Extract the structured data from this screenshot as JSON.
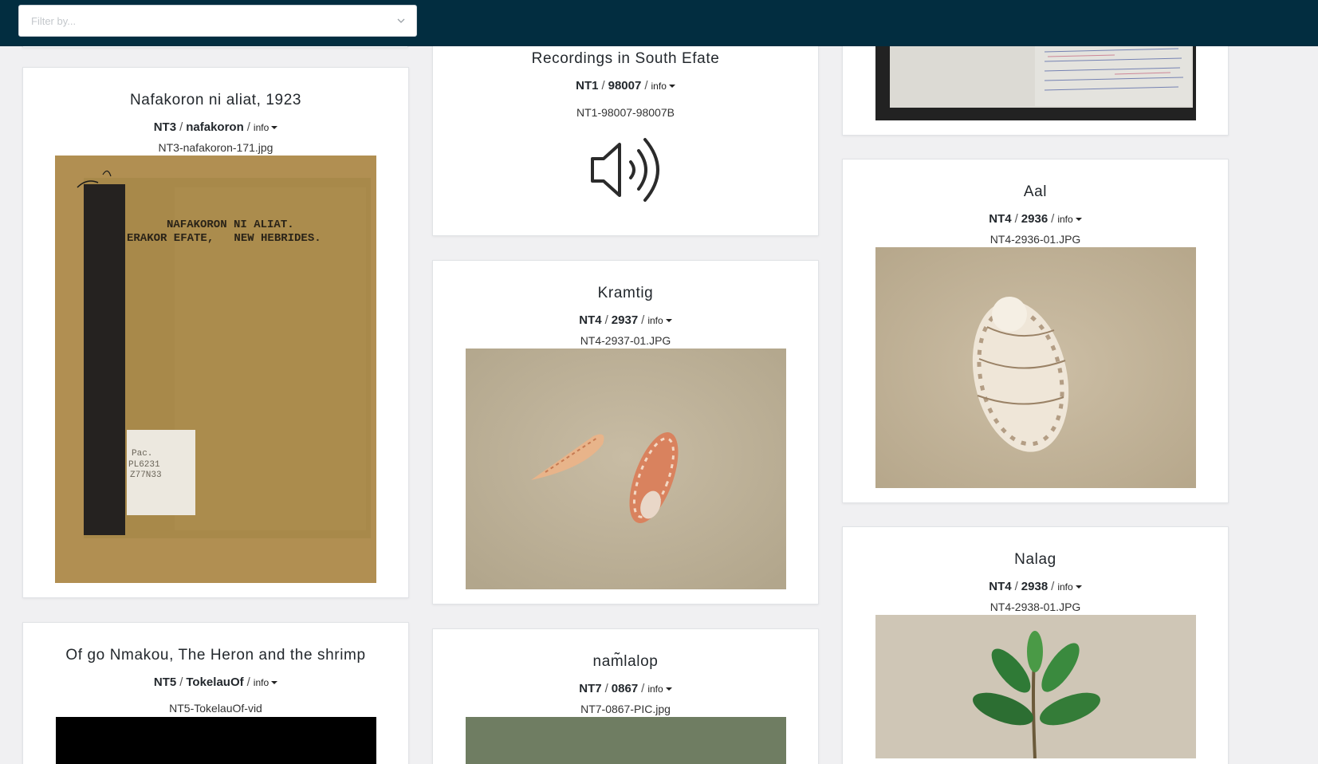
{
  "filter": {
    "placeholder": "Filter by..."
  },
  "cards": {
    "nafakoron": {
      "title": "Nafakoron ni aliat, 1923",
      "collection": "NT3",
      "item": "nafakoron",
      "info": "info",
      "filename": "NT3-nafakoron-171.jpg",
      "cover_line1": "NAFAKORON NI ALIAT.",
      "cover_line2": "ERAKOR EFATE,   NEW HEBRIDES.",
      "label_line1": "Pac.",
      "label_line2": "PL6231",
      "label_line3": "Z77N33"
    },
    "heron": {
      "title": "Of go Nmakou, The Heron and the shrimp",
      "collection": "NT5",
      "item": "TokelauOf",
      "info": "info",
      "filename": "NT5-TokelauOf-vid"
    },
    "recordings": {
      "title": "Recordings in South Efate",
      "collection": "NT1",
      "item": "98007",
      "info": "info",
      "filename": "NT1-98007-98007B"
    },
    "kramtig": {
      "title": "Kramtig",
      "collection": "NT4",
      "item": "2937",
      "info": "info",
      "filename": "NT4-2937-01.JPG"
    },
    "namlalop": {
      "title": "nam̃lalop",
      "collection": "NT7",
      "item": "0867",
      "info": "info",
      "filename": "NT7-0867-PIC.jpg"
    },
    "aal": {
      "title": "Aal",
      "collection": "NT4",
      "item": "2936",
      "info": "info",
      "filename": "NT4-2936-01.JPG"
    },
    "nalag": {
      "title": "Nalag",
      "collection": "NT4",
      "item": "2938",
      "info": "info",
      "filename": "NT4-2938-01.JPG"
    }
  },
  "icons": {
    "audio": "speaker-icon",
    "dropdown": "chevron-down-icon"
  },
  "colors": {
    "topbar": "#022d40",
    "page_bg": "#f0f0f2",
    "card_bg": "#ffffff"
  }
}
